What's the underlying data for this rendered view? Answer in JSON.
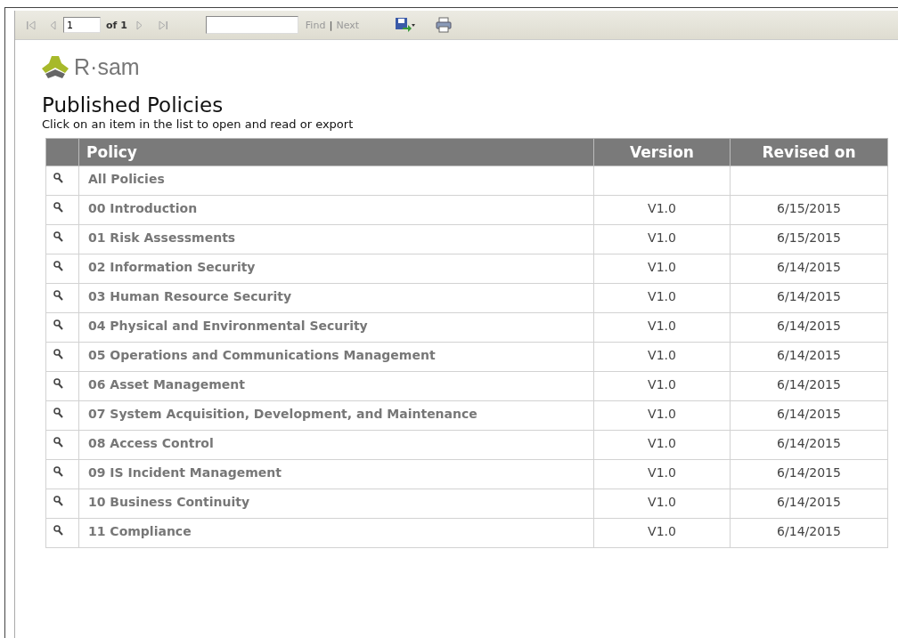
{
  "toolbar": {
    "page_value": "1",
    "page_count": "of 1",
    "find_link": "Find",
    "separator": "|",
    "next_link": "Next"
  },
  "logo": {
    "text": "R·sam"
  },
  "title": "Published Policies",
  "subtitle": "Click on an item in the list to open and read or export",
  "table": {
    "columns": [
      "Policy",
      "Version",
      "Revised on"
    ],
    "rows": [
      {
        "policy": "All Policies",
        "version": "",
        "revised": ""
      },
      {
        "policy": "00 Introduction",
        "version": "V1.0",
        "revised": "6/15/2015"
      },
      {
        "policy": "01 Risk Assessments",
        "version": "V1.0",
        "revised": "6/15/2015"
      },
      {
        "policy": "02 Information Security",
        "version": "V1.0",
        "revised": "6/14/2015"
      },
      {
        "policy": "03 Human Resource Security",
        "version": "V1.0",
        "revised": "6/14/2015"
      },
      {
        "policy": "04 Physical and Environmental Security",
        "version": "V1.0",
        "revised": "6/14/2015"
      },
      {
        "policy": "05 Operations and Communications Management",
        "version": "V1.0",
        "revised": "6/14/2015"
      },
      {
        "policy": "06 Asset Management",
        "version": "V1.0",
        "revised": "6/14/2015"
      },
      {
        "policy": "07 System Acquisition, Development, and Maintenance",
        "version": "V1.0",
        "revised": "6/14/2015"
      },
      {
        "policy": "08 Access Control",
        "version": "V1.0",
        "revised": "6/14/2015"
      },
      {
        "policy": "09 IS Incident Management",
        "version": "V1.0",
        "revised": "6/14/2015"
      },
      {
        "policy": "10 Business Continuity",
        "version": "V1.0",
        "revised": "6/14/2015"
      },
      {
        "policy": "11 Compliance",
        "version": "V1.0",
        "revised": "6/14/2015"
      }
    ]
  }
}
